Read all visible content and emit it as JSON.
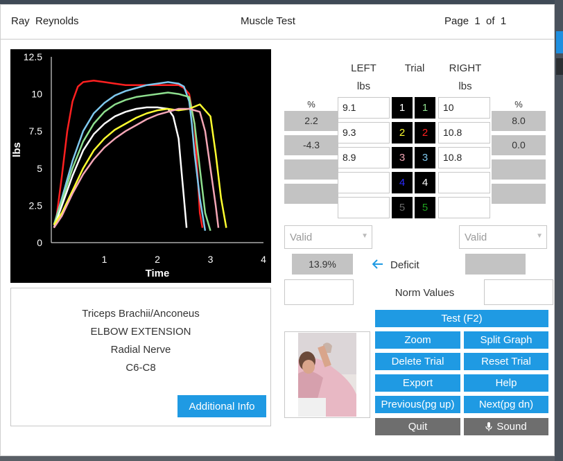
{
  "header": {
    "patient_name": "Ray  Reynolds",
    "title": "Muscle Test",
    "page_label": "Page  1  of  1"
  },
  "chart_data": {
    "type": "line",
    "xlabel": "Time",
    "ylabel": "lbs",
    "xlim": [
      0,
      4
    ],
    "ylim": [
      0,
      12.5
    ],
    "x_ticks": [
      "1",
      "2",
      "3",
      "4"
    ],
    "y_ticks": [
      "0",
      "2.5",
      "5",
      "7.5",
      "10",
      "12.5"
    ],
    "background": "#000000",
    "series": [
      {
        "color": "#ff2020",
        "x": [
          0.05,
          0.1,
          0.2,
          0.3,
          0.4,
          0.5,
          0.6,
          0.8,
          1.0,
          1.2,
          1.4,
          1.6,
          1.8,
          2.0,
          2.2,
          2.4,
          2.5,
          2.6,
          2.7,
          2.75,
          2.8,
          2.85
        ],
        "y": [
          1.2,
          1.8,
          4.5,
          7.5,
          9.5,
          10.5,
          10.8,
          10.9,
          10.8,
          10.7,
          10.6,
          10.6,
          10.6,
          10.6,
          10.6,
          10.6,
          10.4,
          10.0,
          8.0,
          5.0,
          2.0,
          1.0
        ]
      },
      {
        "color": "#7ec8ee",
        "x": [
          0.05,
          0.2,
          0.4,
          0.6,
          0.8,
          1.0,
          1.2,
          1.4,
          1.6,
          1.8,
          2.0,
          2.2,
          2.4,
          2.5,
          2.6,
          2.65,
          2.7,
          2.8,
          2.9
        ],
        "y": [
          1.2,
          3.0,
          5.5,
          7.5,
          8.7,
          9.4,
          9.9,
          10.2,
          10.4,
          10.6,
          10.7,
          10.8,
          10.7,
          10.5,
          9.5,
          8.0,
          6.0,
          3.0,
          0.8
        ]
      },
      {
        "color": "#8fe08f",
        "x": [
          0.05,
          0.2,
          0.4,
          0.6,
          0.8,
          1.0,
          1.2,
          1.4,
          1.6,
          1.8,
          2.0,
          2.2,
          2.4,
          2.6,
          2.7,
          2.8,
          2.9,
          3.0
        ],
        "y": [
          1.2,
          2.8,
          5.0,
          6.8,
          8.0,
          8.8,
          9.3,
          9.6,
          9.8,
          9.9,
          10.0,
          10.1,
          10.0,
          9.8,
          8.0,
          5.0,
          2.0,
          0.8
        ]
      },
      {
        "color": "#ffffff",
        "x": [
          0.05,
          0.2,
          0.4,
          0.6,
          0.8,
          1.0,
          1.2,
          1.4,
          1.6,
          1.8,
          2.0,
          2.2,
          2.3,
          2.4,
          2.45,
          2.5,
          2.55
        ],
        "y": [
          1.0,
          2.5,
          4.5,
          6.2,
          7.3,
          8.0,
          8.5,
          8.8,
          9.0,
          9.1,
          9.1,
          9.0,
          8.5,
          7.0,
          5.0,
          3.0,
          1.0
        ]
      },
      {
        "color": "#ffff30",
        "x": [
          0.05,
          0.2,
          0.4,
          0.6,
          0.8,
          1.0,
          1.2,
          1.4,
          1.6,
          1.8,
          2.0,
          2.2,
          2.4,
          2.6,
          2.8,
          3.0,
          3.1,
          3.2,
          3.3
        ],
        "y": [
          1.2,
          2.0,
          3.5,
          5.0,
          6.2,
          7.0,
          7.6,
          8.0,
          8.4,
          8.7,
          8.9,
          9.0,
          8.9,
          9.0,
          9.3,
          8.5,
          6.0,
          3.0,
          1.0
        ]
      },
      {
        "color": "#f4a6b6",
        "x": [
          0.05,
          0.2,
          0.4,
          0.6,
          0.8,
          1.0,
          1.2,
          1.4,
          1.6,
          1.8,
          2.0,
          2.2,
          2.4,
          2.6,
          2.8,
          2.9,
          3.0,
          3.1,
          3.15
        ],
        "y": [
          1.0,
          1.8,
          3.3,
          4.6,
          5.6,
          6.4,
          7.0,
          7.5,
          7.9,
          8.3,
          8.6,
          8.8,
          9.0,
          9.0,
          8.8,
          7.5,
          5.0,
          2.5,
          1.0
        ]
      }
    ]
  },
  "info": {
    "muscle": "Triceps Brachii/Anconeus",
    "movement": "ELBOW EXTENSION",
    "nerve": "Radial Nerve",
    "roots": "C6-C8",
    "additional_info_label": "Additional Info"
  },
  "table": {
    "left_header_1": "LEFT",
    "left_header_2": "lbs",
    "trial_header": "Trial",
    "right_header_1": "RIGHT",
    "right_header_2": "lbs",
    "pct_left": "%",
    "pct_right": "%",
    "left_values": [
      "9.1",
      "9.3",
      "8.9",
      "",
      ""
    ],
    "right_values": [
      "10",
      "10.8",
      "10.8",
      "",
      ""
    ],
    "left_pct": [
      "2.2",
      "-4.3",
      "",
      ""
    ],
    "right_pct": [
      "8.0",
      "0.0",
      "",
      ""
    ],
    "trials_left": [
      {
        "n": "1",
        "color": "#ffffff"
      },
      {
        "n": "2",
        "color": "#ffff30"
      },
      {
        "n": "3",
        "color": "#f4a6b6"
      },
      {
        "n": "4",
        "color": "#2a2aff"
      },
      {
        "n": "5",
        "color": "#6a6a6a"
      }
    ],
    "trials_right": [
      {
        "n": "1",
        "color": "#8fe08f"
      },
      {
        "n": "2",
        "color": "#ff2020"
      },
      {
        "n": "3",
        "color": "#7ec8ee"
      },
      {
        "n": "4",
        "color": "#ffffff"
      },
      {
        "n": "5",
        "color": "#1fa01f"
      }
    ]
  },
  "validity": {
    "left": "Valid",
    "right": "Valid"
  },
  "deficit": {
    "value": "13.9%",
    "label": "Deficit",
    "right_value": ""
  },
  "norm": {
    "label": "Norm Values",
    "left": "",
    "right": ""
  },
  "buttons": {
    "test": "Test (F2)",
    "zoom": "Zoom",
    "split_graph": "Split Graph",
    "delete_trial": "Delete Trial",
    "reset_trial": "Reset Trial",
    "export": "Export",
    "help": "Help",
    "previous": "Previous(pg up)",
    "next": "Next(pg dn)",
    "quit": "Quit",
    "sound": "Sound"
  },
  "colors": {
    "accent": "#1f9ae3",
    "gray_button": "#6e6e6e",
    "value_box": "#c3c3c3"
  }
}
